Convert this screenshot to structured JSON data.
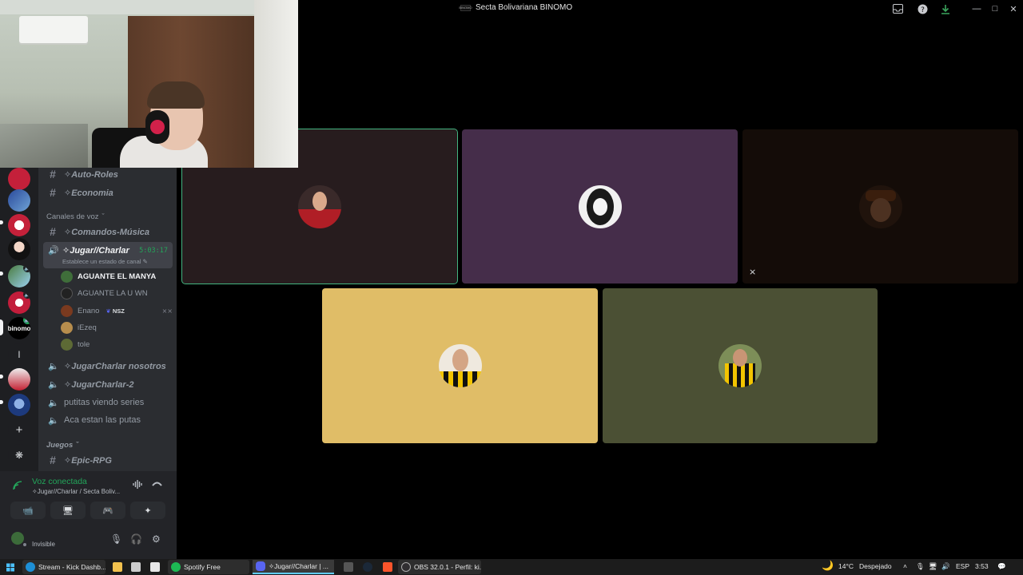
{
  "window": {
    "title": "Secta Bolivariana BINOMO",
    "server_mini": "BINOMO"
  },
  "channels": {
    "text_top": [
      {
        "name": "✧Auto-Roles"
      },
      {
        "name": "✧Economia"
      }
    ],
    "voice_category": "Canales de voz",
    "commands_channel": "✧Comandos-Música",
    "active_voice": {
      "name": "✧Jugar//Charlar",
      "timer": "5:03:17",
      "status": "Establece un estado de canal"
    },
    "voice_users": [
      {
        "name": "AGUANTE EL MANYA",
        "color": "#3f6e3a"
      },
      {
        "name": "AGUANTE LA U WN",
        "color": "#222"
      },
      {
        "name": "Enano",
        "badge": "NSZ",
        "color": "#7a3a1f"
      },
      {
        "name": "iEzeq",
        "color": "#b78d4d"
      },
      {
        "name": "tole",
        "color": "#5d6a35"
      }
    ],
    "other_voice": [
      {
        "name": "✧JugarCharlar nosotros"
      },
      {
        "name": "✧JugarCharlar-2"
      },
      {
        "name": "putitas viendo series"
      },
      {
        "name": "Aca estan las putas"
      }
    ],
    "games_category": "Juegos",
    "games_channel": "✧Epic-RPG"
  },
  "voice_panel": {
    "title": "Voz conectada",
    "subtitle": "✧Jugar//Charlar / Secta Boliv...",
    "user_status": "Invisible"
  },
  "servers": {
    "binomo_label": "binomo",
    "letter": "l"
  },
  "stage": {
    "tiles": [
      {
        "bg": "#271c1e",
        "speaking": true
      },
      {
        "bg": "#452d4a"
      },
      {
        "bg": "#140c08",
        "muted": true
      },
      {
        "bg": "#e0bd67"
      },
      {
        "bg": "#4b5034"
      }
    ]
  },
  "taskbar": {
    "items": [
      {
        "label": "Stream - Kick Dashb..."
      },
      {
        "label": "Spotify Free"
      },
      {
        "label": "✧Jugar//Charlar | ..."
      },
      {
        "label": "OBS 32.0.1 - Perfil: ki..."
      }
    ],
    "weather_temp": "14°C",
    "weather_text": "Despejado",
    "lang": "ESP",
    "time": "3:53"
  }
}
